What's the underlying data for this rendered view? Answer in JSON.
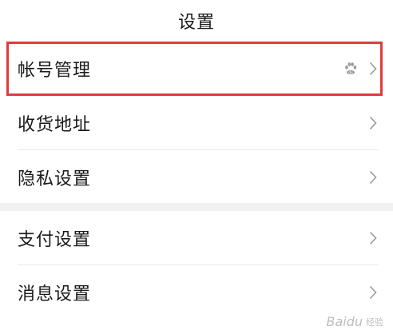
{
  "header": {
    "title": "设置"
  },
  "groups": [
    {
      "items": [
        {
          "label": "帐号管理",
          "badge_icon": "baidu-paw-icon",
          "highlighted": true
        },
        {
          "label": "收货地址"
        },
        {
          "label": "隐私设置"
        }
      ]
    },
    {
      "items": [
        {
          "label": "支付设置"
        },
        {
          "label": "消息设置"
        }
      ]
    }
  ],
  "colors": {
    "highlight_border": "#e23b3b",
    "chevron": "#9a9a9a",
    "divider": "#e8e8e8",
    "section_gap": "#f1f1f1"
  },
  "watermark": {
    "brand": "Baidu",
    "sub": "经验"
  }
}
